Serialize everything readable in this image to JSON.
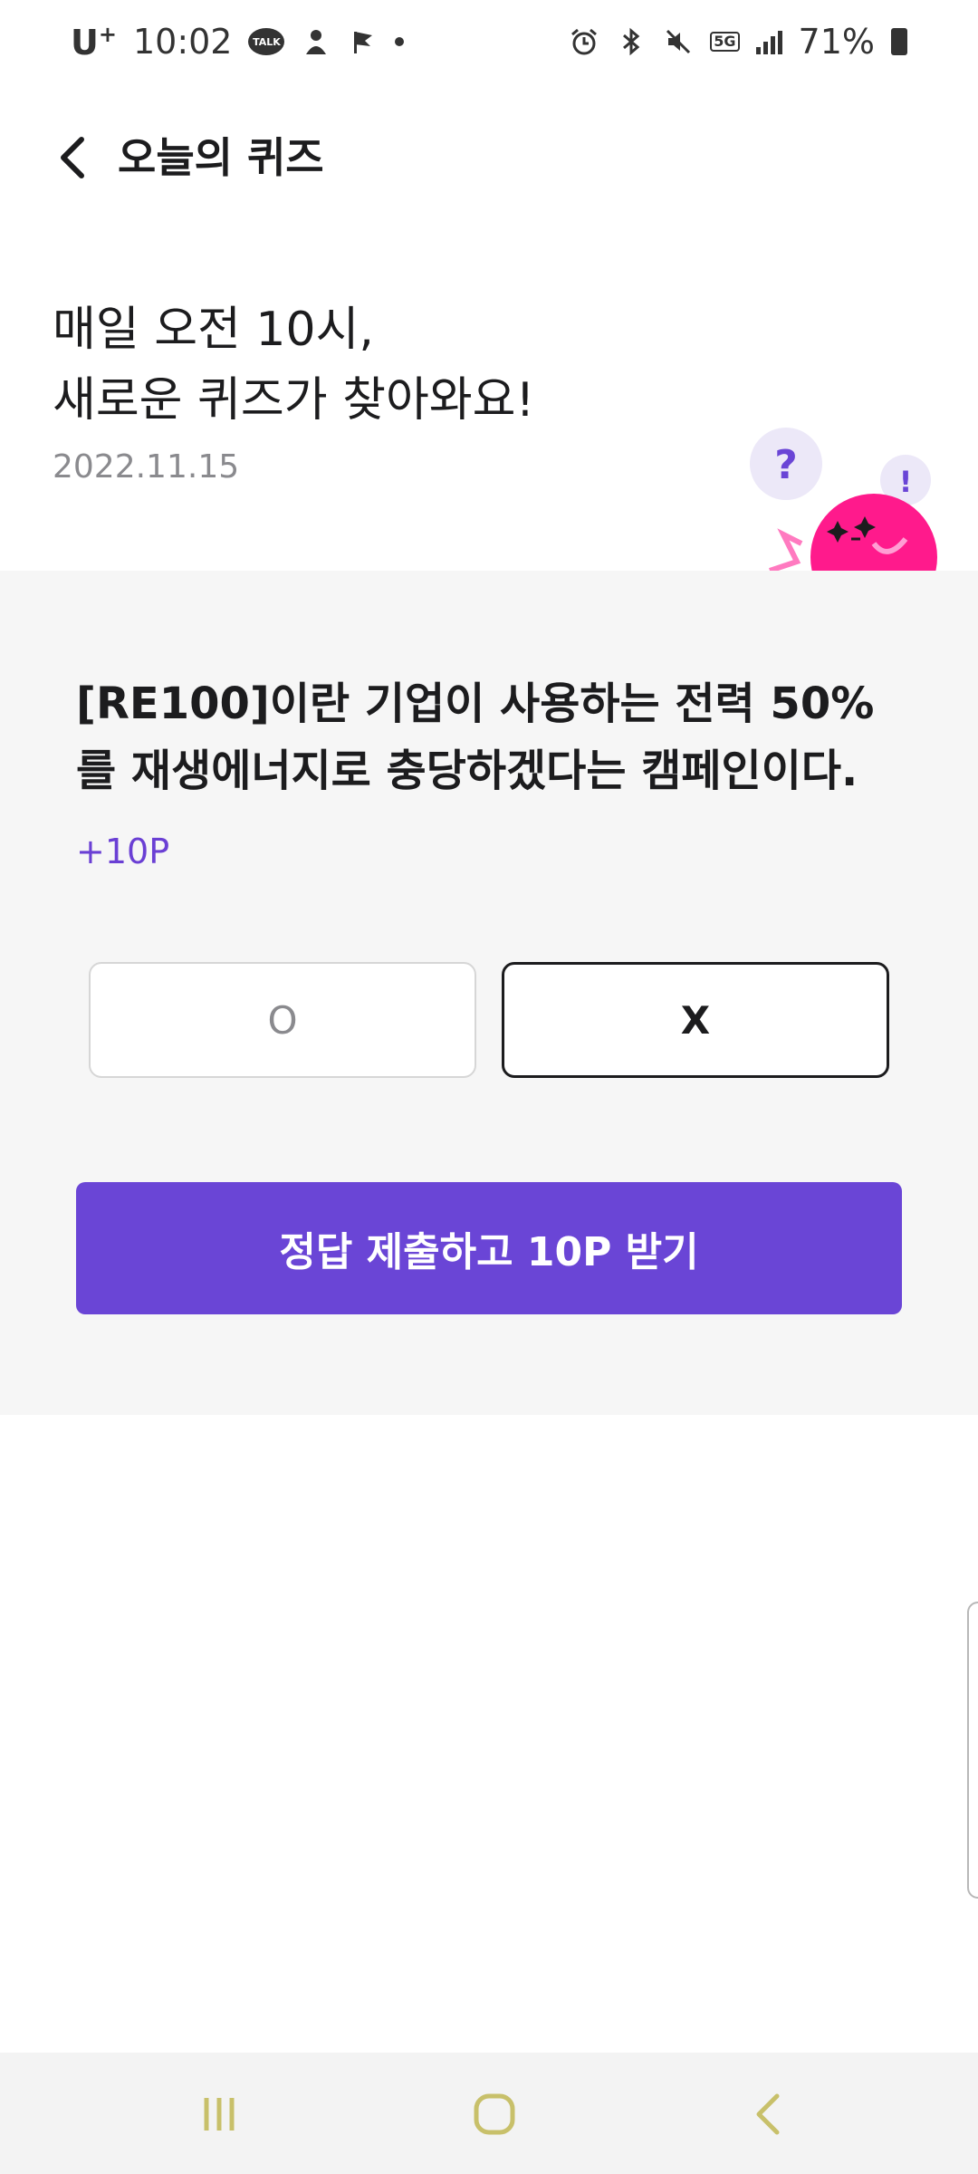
{
  "status_bar": {
    "carrier": "U",
    "carrier_sup": "+",
    "time": "10:02",
    "talk_icon_text": "TALK",
    "network": "5G",
    "battery_percent": "71%"
  },
  "header": {
    "title": "오늘의 퀴즈"
  },
  "intro": {
    "line1": "매일 오전 10시,",
    "line2": "새로운 퀴즈가 찾아와요!",
    "date": "2022.11.15"
  },
  "mascot": {
    "question_mark": "?",
    "exclamation": "!"
  },
  "quiz": {
    "question": "[RE100]이란 기업이 사용하는 전력 50%를 재생에너지로 충당하겠다는 캠페인이다.",
    "points": "+10P",
    "answer_o": "O",
    "answer_x": "X",
    "selected_answer": "X",
    "submit_label": "정답 제출하고 10P 받기"
  },
  "colors": {
    "accent": "#6a45d6",
    "points_text": "#6a3fd4",
    "mascot_pink": "#ff1a8c",
    "nav_icon": "#c8c06a"
  },
  "nav_bar": {
    "icons": [
      "recent-apps-icon",
      "home-icon",
      "back-icon"
    ]
  }
}
